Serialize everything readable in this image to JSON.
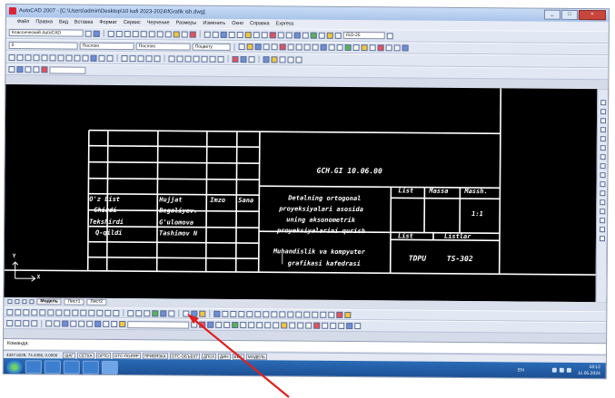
{
  "window": {
    "title": "AutoCAD 2007 - [C:\\Users\\admin\\Desktop\\10 kafi 2023-2024\\fGrafik ish.dwg]",
    "controls": [
      "_",
      "□",
      "×"
    ]
  },
  "menu": [
    "Файл",
    "Правка",
    "Вид",
    "Вставка",
    "Формат",
    "Сервис",
    "Черчение",
    "Размеры",
    "Изменить",
    "Окно",
    "Справка",
    "Express"
  ],
  "toolbar": {
    "workspace_value": "Классический AutoCAD",
    "layer_value": "0",
    "linetype_value": "Послою",
    "lineweight_value": "Послою",
    "plotstyle_value": "Поцвету",
    "scale_value": "ISO-25"
  },
  "title_block": {
    "code": "GCH.GI 10.06.00",
    "roles": [
      "O'z List",
      "Chizdi",
      "Tekshirdi",
      "Q-qildi"
    ],
    "names": [
      "Hujjat",
      "Begaliyev.",
      "G'ulomova",
      "Tashimov N"
    ],
    "col_imzo": "Imzo",
    "col_sana": "Sana",
    "description": [
      "Detalning ortogonal",
      "proyeksiyalari asosida",
      "uning aksonometrik",
      "proyeksiyalarini qurish"
    ],
    "headers": {
      "list": "List",
      "massa": "Massa",
      "masshtab": "Massh."
    },
    "scale": "1:1",
    "sheet_label": "List",
    "sheets_label": "Listlar",
    "department": [
      "Muhandislik va kompyuter",
      "grafikasi kafedrasi"
    ],
    "university": "TDPU",
    "group": "TS-302"
  },
  "ucs": {
    "x": "X",
    "y": "Y"
  },
  "layout_tabs": [
    "Модель",
    "Лист1",
    "Лист2"
  ],
  "command": {
    "prompt": "Команда:"
  },
  "status": {
    "coords": "4327.8226, 74.4356, 0.0000",
    "buttons": [
      "ШАГ",
      "СЕТКА",
      "ОРТО",
      "ОТС-ПОЛЯР",
      "ПРИВЯЗКА",
      "ОТС-ОБЪЕКТ",
      "ДПСК",
      "ДИН",
      "ВЕС",
      "МОДЕЛЬ"
    ]
  },
  "tray": {
    "lang": "EN",
    "time": "18:12",
    "date": "11.05.2024"
  },
  "colors": {
    "annotation_arrow": "#e0201c",
    "drawing_bg": "#000000"
  }
}
